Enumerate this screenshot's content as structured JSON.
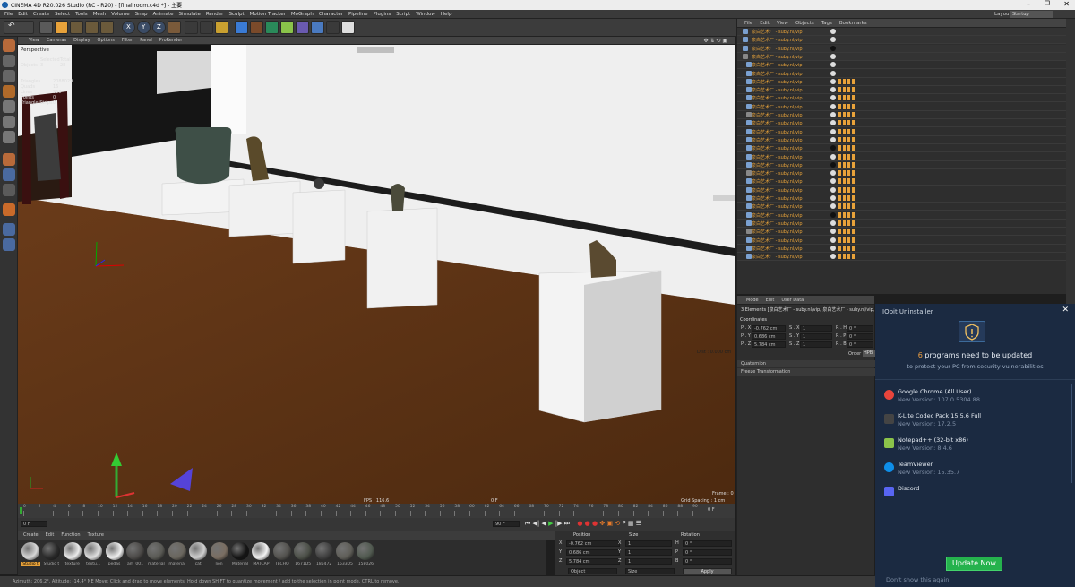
{
  "window": {
    "title": "CINEMA 4D R20.026 Studio (RC - R20) - [final room.c4d *] - 主要"
  },
  "menu": [
    "File",
    "Edit",
    "Create",
    "Select",
    "Tools",
    "Mesh",
    "Volume",
    "Snap",
    "Animate",
    "Simulate",
    "Render",
    "Sculpt",
    "Motion Tracker",
    "MoGraph",
    "Character",
    "Pipeline",
    "Plugins",
    "Script",
    "Window",
    "Help"
  ],
  "layout": {
    "label": "Layout:",
    "value": "Startup"
  },
  "viewport": {
    "menu": [
      "View",
      "Cameras",
      "Display",
      "Options",
      "Filter",
      "Panel",
      "ProRender"
    ],
    "camera": "Perspective",
    "stats": {
      "header_selected": "Selected",
      "header_total": "Total",
      "objects_label": "Objects",
      "objects_selected": "3",
      "objects_total": "28",
      "triangles_label": "Triangles",
      "triangles_value": "2088029",
      "quads_label": "Quads",
      "quads_value": "16",
      "lines_label": "Lines",
      "lines_value": "958",
      "points_label": "Points",
      "points_value": "0",
      "strips_label": "Triangle Strips",
      "strips_value": "0"
    },
    "fps": "FPS : 116.6",
    "frame_label": "Frame : 0",
    "grid_spacing": "Grid Spacing : 1 cm",
    "dist": "Dist : 0.000 cm",
    "timecode": "0 F"
  },
  "timeline": {
    "ticks": [
      "0",
      "2",
      "4",
      "6",
      "8",
      "10",
      "12",
      "14",
      "16",
      "18",
      "20",
      "22",
      "24",
      "26",
      "28",
      "30",
      "32",
      "34",
      "36",
      "38",
      "40",
      "42",
      "44",
      "46",
      "48",
      "50",
      "52",
      "54",
      "56",
      "58",
      "60",
      "62",
      "64",
      "66",
      "68",
      "70",
      "72",
      "74",
      "76",
      "78",
      "80",
      "82",
      "84",
      "86",
      "88",
      "90"
    ],
    "current": "0 F",
    "start": "0 F",
    "end": "90 F"
  },
  "materials": {
    "menu": [
      "Create",
      "Edit",
      "Function",
      "Texture"
    ],
    "items": [
      {
        "label": "Studio t",
        "color": "#d8d8d8"
      },
      {
        "label": "Studio t",
        "color": "#2a2a2a"
      },
      {
        "label": "texture",
        "color": "#ececec"
      },
      {
        "label": "textu...",
        "color": "#e0e0e0"
      },
      {
        "label": "pedas",
        "color": "#f0f0f0"
      },
      {
        "label": "am_001",
        "color": "#4c4a48"
      },
      {
        "label": "material",
        "color": "#5a5a55"
      },
      {
        "label": "material",
        "color": "#6a665e"
      },
      {
        "label": "cat",
        "color": "#cfcfcf"
      },
      {
        "label": "lion",
        "color": "#7a6e62"
      },
      {
        "label": "Material",
        "color": "#151515"
      },
      {
        "label": "MATCAP",
        "color": "#f4f4f4"
      },
      {
        "label": "TECHO",
        "color": "#53524e"
      },
      {
        "label": "1671D5",
        "color": "#4c5048"
      },
      {
        "label": "185472",
        "color": "#3f3f3f"
      },
      {
        "label": "1533D5",
        "color": "#5f5e58"
      },
      {
        "label": "158026",
        "color": "#515a50"
      }
    ]
  },
  "coords": {
    "headers": [
      "Position",
      "Size",
      "Rotation"
    ],
    "rows": [
      {
        "axis": "X",
        "pos": "-0.762 cm",
        "size": "1",
        "rlabel": "H",
        "rot": "0 °"
      },
      {
        "axis": "Y",
        "pos": "0.686 cm",
        "size": "1",
        "rlabel": "P",
        "rot": "0 °"
      },
      {
        "axis": "Z",
        "pos": "5.784 cm",
        "size": "1",
        "rlabel": "B",
        "rot": "0 °"
      }
    ],
    "mode": "Object",
    "size_mode": "Size",
    "apply": "Apply"
  },
  "status": "Azimuth: 206.2°, Altitude: -14.4° NE   Move: Click and drag to move elements. Hold down SHIFT to quantize movement / add to the selection in point mode, CTRL to remove.",
  "objects": {
    "menu": [
      "File",
      "Edit",
      "View",
      "Objects",
      "Tags",
      "Bookmarks"
    ],
    "rows": [
      "泉白艺术厂 - suby.nl/vip",
      "泉白艺术厂 - suby.nl/vip",
      "泉白艺术厂 - suby.nl/vip",
      "泉白艺术厂 - suby.nl/vip",
      "泉白艺术厂 - suby.nl/vip",
      "泉白艺术厂 - suby.nl/vip",
      "泉白艺术厂 - suby.nl/vip",
      "泉白艺术厂 - suby.nl/vip",
      "泉白艺术厂 - suby.nl/vip",
      "泉白艺术厂 - suby.nl/vip",
      "泉白艺术厂 - suby.nl/vip",
      "泉白艺术厂 - suby.nl/vip",
      "泉白艺术厂 - suby.nl/vip",
      "泉白艺术厂 - suby.nl/vip",
      "泉白艺术厂 - suby.nl/vip",
      "泉白艺术厂 - suby.nl/vip",
      "泉白艺术厂 - suby.nl/vip",
      "泉白艺术厂 - suby.nl/vip",
      "泉白艺术厂 - suby.nl/vip",
      "泉白艺术厂 - suby.nl/vip",
      "泉白艺术厂 - suby.nl/vip",
      "泉白艺术厂 - suby.nl/vip",
      "泉白艺术厂 - suby.nl/vip",
      "泉白艺术厂 - suby.nl/vip",
      "泉白艺术厂 - suby.nl/vip",
      "泉白艺术厂 - suby.nl/vip",
      "泉白艺术厂 - suby.nl/vip",
      "泉白艺术厂 - suby.nl/vip"
    ]
  },
  "attributes": {
    "menu": [
      "Mode",
      "Edit",
      "User Data"
    ],
    "title": "3 Elements [泉白艺术厂 - suby.nl/vip, 泉白艺术厂 - suby.nl/vip, 泉白艺术厂 - suby.nl/vip]",
    "tab": "Coordinates",
    "rows": [
      {
        "a": "P . X",
        "v": "-0.762 cm",
        "b": "S . X",
        "w": "1",
        "c": "R . H",
        "r": "0 °"
      },
      {
        "a": "P . Y",
        "v": "0.686 cm",
        "b": "S . Y",
        "w": "1",
        "c": "R . P",
        "r": "0 °"
      },
      {
        "a": "P . Z",
        "v": "5.784 cm",
        "b": "S . Z",
        "w": "1",
        "c": "R . B",
        "r": "0 °"
      }
    ],
    "order_label": "Order",
    "order_value": "HPB",
    "sections": [
      "Quaternion",
      "Freeze Transformation"
    ]
  },
  "iobit": {
    "title": "IObit Uninstaller",
    "count": "6",
    "headline_rest": "programs need to be updated",
    "subtitle": "to protect your PC from security vulnerabilities",
    "programs": [
      {
        "name": "Google Chrome (All User)",
        "version": "New Version: 107.0.5304.88",
        "color": "#e8453c"
      },
      {
        "name": "K-Lite Codec Pack 15.5.6 Full",
        "version": "New Version: 17.2.5",
        "color": "#444444"
      },
      {
        "name": "Notepad++ (32-bit x86)",
        "version": "New Version: 8.4.6",
        "color": "#8bc34a"
      },
      {
        "name": "TeamViewer",
        "version": "New Version: 15.35.7",
        "color": "#0e8ee9"
      },
      {
        "name": "Discord",
        "version": "",
        "color": "#5865f2"
      }
    ],
    "button": "Update Now",
    "dont_show": "Don't show this again"
  }
}
